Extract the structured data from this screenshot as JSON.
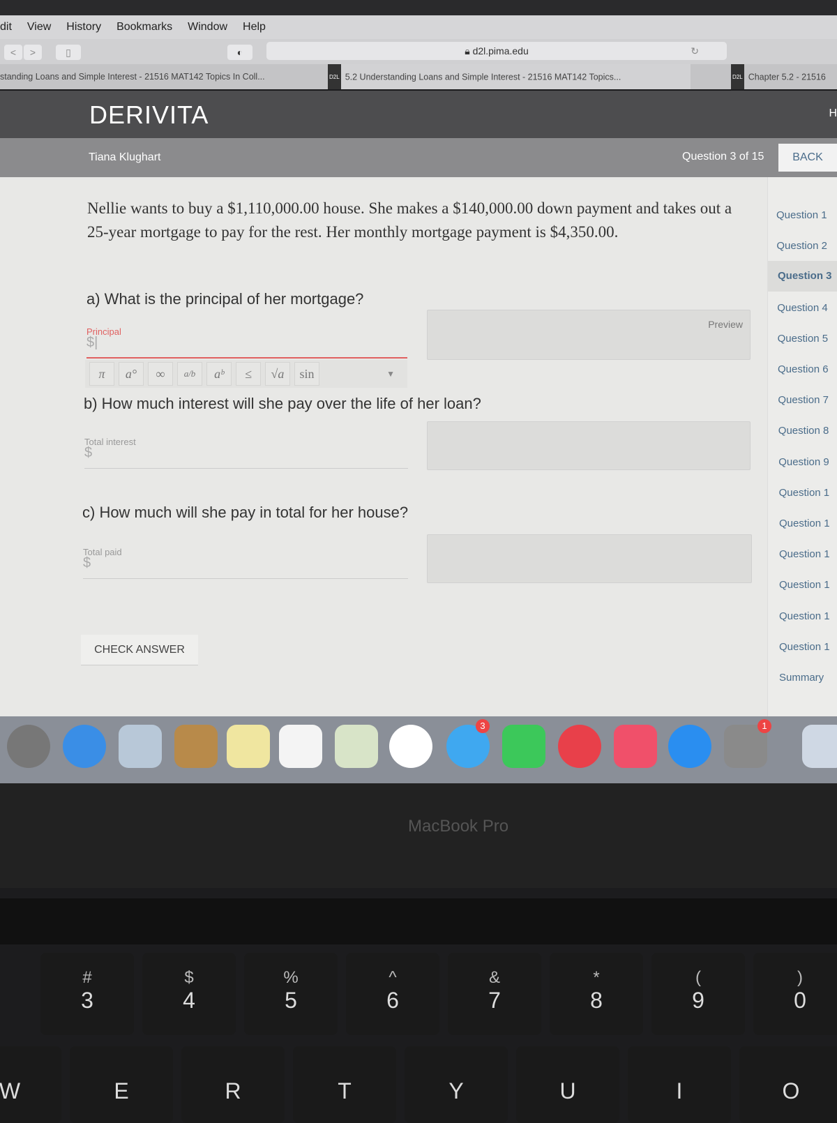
{
  "menubar": {
    "items": [
      "dit",
      "View",
      "History",
      "Bookmarks",
      "Window",
      "Help"
    ]
  },
  "toolbar": {
    "url": "d2l.pima.edu",
    "back": "<",
    "forward": ">"
  },
  "tabs": [
    {
      "label": "standing Loans and Simple Interest - 21516 MAT142 Topics In Coll..."
    },
    {
      "label": "5.2 Understanding Loans and Simple Interest - 21516 MAT142 Topics...",
      "badge": "D2L"
    },
    {
      "label": "Chapter 5.2 - 21516",
      "badge": "D2L"
    }
  ],
  "header": {
    "logo": "DERIVITA",
    "user": "Tiana Klughart",
    "progress": "Question 3 of 15",
    "back": "BACK",
    "right_cut": "H"
  },
  "problem": {
    "text": "Nellie wants to buy a $1,110,000.00 house. She makes a $140,000.00 down payment and takes out a 25-year mortgage to pay for the rest. Her monthly mortgage payment is $4,350.00.",
    "parts": [
      {
        "question": "a) What is the principal of her mortgage?",
        "label": "Principal",
        "prefix": "$",
        "preview": "Preview"
      },
      {
        "question": "b) How much interest will she pay over the life of her loan?",
        "label": "Total interest",
        "prefix": "$"
      },
      {
        "question": "c) How much will she pay in total for her house?",
        "label": "Total paid",
        "prefix": "$"
      }
    ]
  },
  "math_toolbar": [
    "π",
    "a°",
    "∞",
    "a/b",
    "aᵇ",
    "≤",
    "√a",
    "sin"
  ],
  "check_answer": "CHECK ANSWER",
  "sidebar": {
    "items": [
      "Question 1",
      "Question 2",
      "Question 3",
      "Question 4",
      "Question 5",
      "Question 6",
      "Question 7",
      "Question 8",
      "Question 9",
      "Question 1",
      "Question 1",
      "Question 1",
      "Question 1",
      "Question 1",
      "Question 1",
      "Summary"
    ],
    "selected": 2
  },
  "dock": {
    "messages_badge": "3",
    "prefs_badge": "1"
  },
  "laptop": {
    "label": "MacBook Pro"
  },
  "keys": [
    {
      "t": "#",
      "b": "3"
    },
    {
      "t": "$",
      "b": "4"
    },
    {
      "t": "%",
      "b": "5"
    },
    {
      "t": "^",
      "b": "6"
    },
    {
      "t": "&",
      "b": "7"
    },
    {
      "t": "*",
      "b": "8"
    },
    {
      "t": "(",
      "b": "9"
    },
    {
      "t": ")",
      "b": "0"
    }
  ],
  "letters": [
    "W",
    "E",
    "R",
    "T",
    "Y",
    "U",
    "I",
    "O"
  ],
  "colors": {
    "error": "#e06060",
    "link": "#4a6c8a",
    "header": "#4d4d4f"
  }
}
